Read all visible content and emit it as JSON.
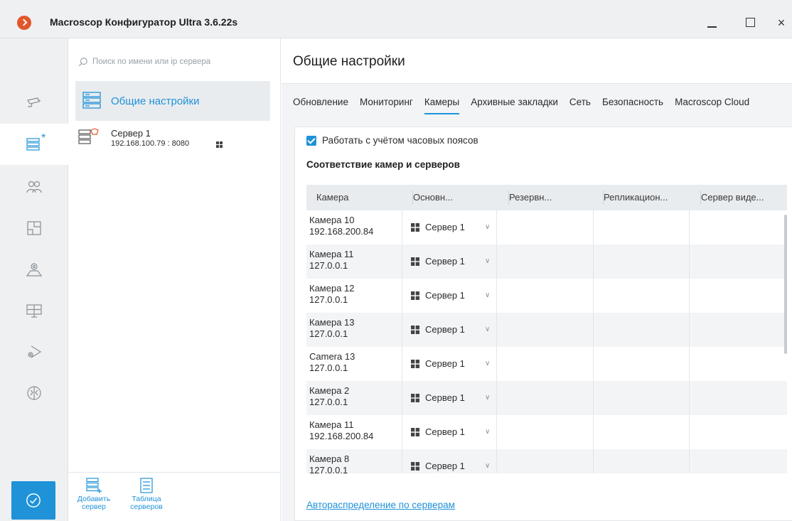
{
  "window": {
    "title": "Macroscop Конфигуратор Ultra 3.6.22s",
    "minimize": "",
    "maximize": "",
    "close": "×",
    "accent": "#1f92d8",
    "logo_color": "#e2562b"
  },
  "rail": {
    "items": [
      {
        "icon": "camera-icon"
      },
      {
        "icon": "servers-icon",
        "badge": "*"
      },
      {
        "icon": "users-icon"
      },
      {
        "icon": "layouts-icon"
      },
      {
        "icon": "map-icon"
      },
      {
        "icon": "workstation-icon"
      },
      {
        "icon": "camera-settings-icon"
      },
      {
        "icon": "brain-icon"
      }
    ],
    "apply_icon": "check-circle-icon"
  },
  "servers_panel": {
    "search_placeholder": "Поиск по имени или ip сервера",
    "general_label": "Общие настройки",
    "server": {
      "name": "Сервер 1",
      "address": "192.168.100.79 : 8080"
    },
    "add_server": "Добавить сервер",
    "server_table": "Таблица серверов"
  },
  "main": {
    "title": "Общие настройки",
    "tabs": [
      {
        "label": "Обновление",
        "active": false
      },
      {
        "label": "Мониторинг",
        "active": false
      },
      {
        "label": "Камеры",
        "active": true
      },
      {
        "label": "Архивные закладки",
        "active": false
      },
      {
        "label": "Сеть",
        "active": false
      },
      {
        "label": "Безопасность",
        "active": false
      },
      {
        "label": "Macroscop Cloud",
        "active": false
      }
    ],
    "timezone_checkbox": {
      "label": "Работать с учётом часовых поясов",
      "checked": true
    },
    "section_title": "Соответствие камер и серверов",
    "columns": [
      "Камера",
      "Основн...",
      "Резервн...",
      "Репликацион...",
      "Сервер виде..."
    ],
    "rows": [
      {
        "camera": "Камера 10",
        "ip": "192.168.200.84",
        "main_server": "Сервер 1"
      },
      {
        "camera": "Камера 11",
        "ip": "127.0.0.1",
        "main_server": "Сервер 1"
      },
      {
        "camera": "Камера 12",
        "ip": "127.0.0.1",
        "main_server": "Сервер 1"
      },
      {
        "camera": "Камера 13",
        "ip": "127.0.0.1",
        "main_server": "Сервер 1"
      },
      {
        "camera": "Camera 13",
        "ip": "127.0.0.1",
        "main_server": "Сервер 1"
      },
      {
        "camera": "Камера 2",
        "ip": "127.0.0.1",
        "main_server": "Сервер 1"
      },
      {
        "camera": "Камера 11",
        "ip": "192.168.200.84",
        "main_server": "Сервер 1"
      },
      {
        "camera": "Камера 8",
        "ip": "127.0.0.1",
        "main_server": "Сервер 1"
      }
    ],
    "autodistribute_link": "Автораспределение по серверам"
  }
}
